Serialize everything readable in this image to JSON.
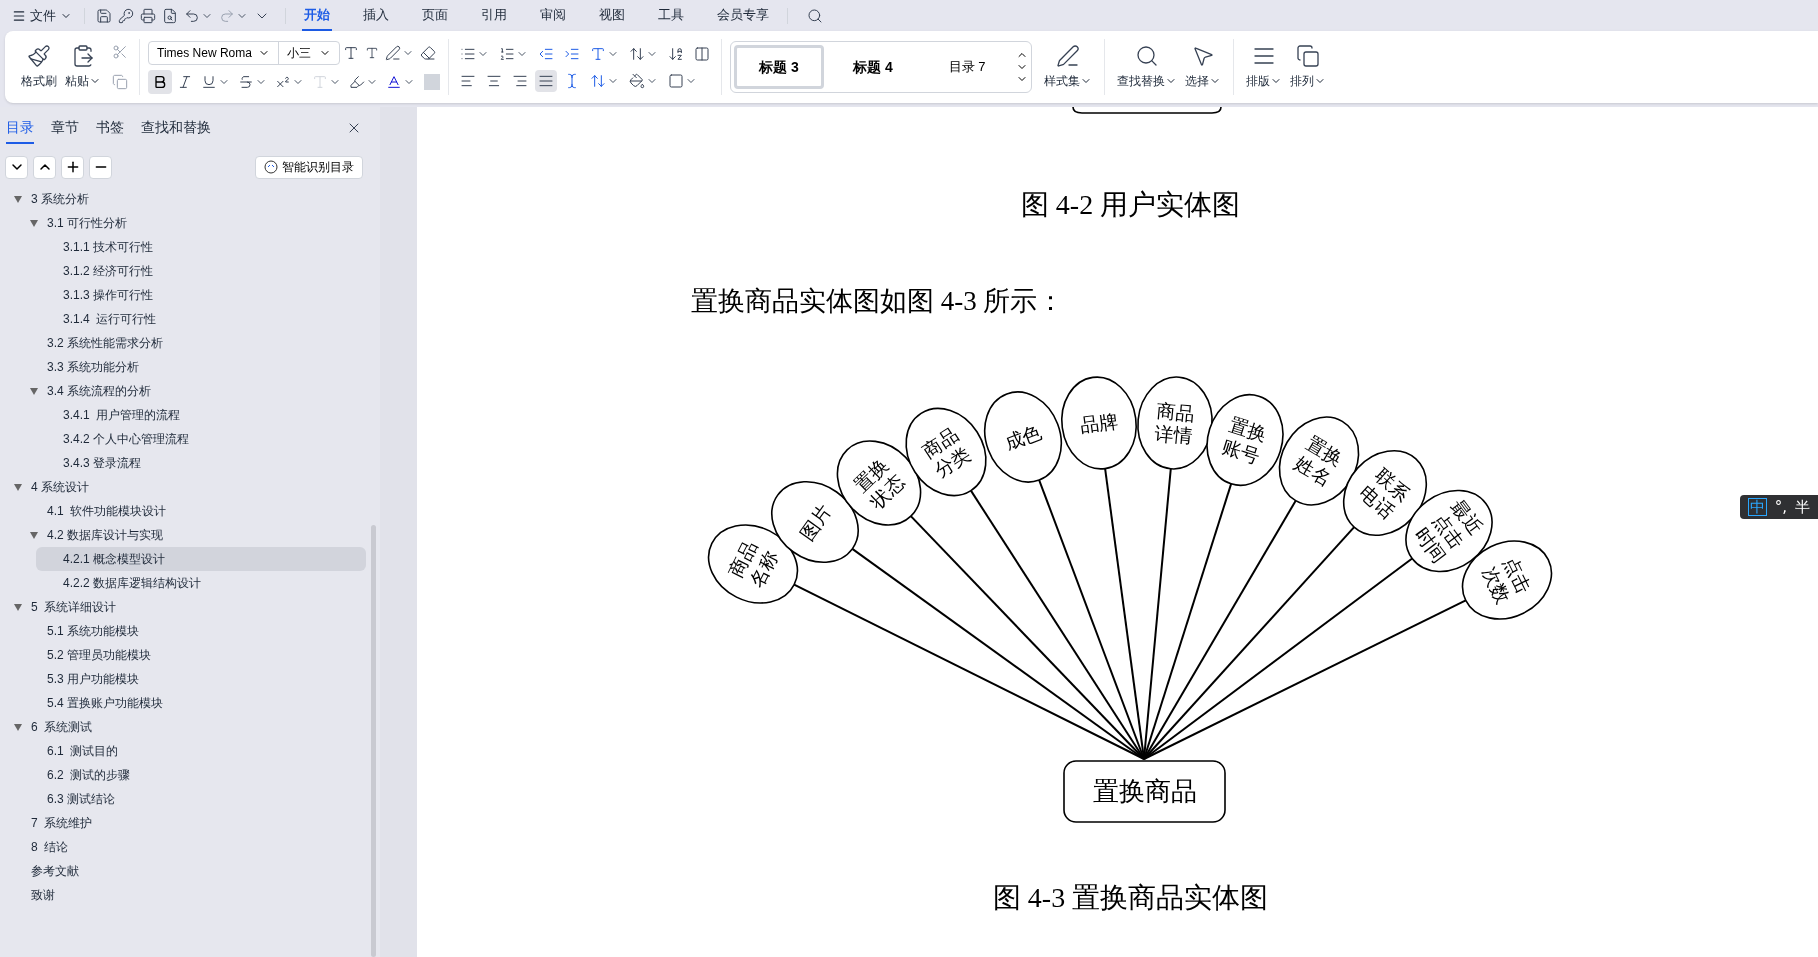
{
  "menu_bar": {
    "file_menu": "文件",
    "tabs": [
      {
        "label": "开始",
        "selected": true
      },
      {
        "label": "插入",
        "selected": false
      },
      {
        "label": "页面",
        "selected": false
      },
      {
        "label": "引用",
        "selected": false
      },
      {
        "label": "审阅",
        "selected": false
      },
      {
        "label": "视图",
        "selected": false
      },
      {
        "label": "工具",
        "selected": false
      },
      {
        "label": "会员专享",
        "selected": false
      }
    ]
  },
  "ribbon": {
    "format_painter": "格式刷",
    "paste": "粘贴",
    "font_name": "Times New Roma",
    "font_size": "小三",
    "bold": true,
    "justified": true,
    "styles": [
      {
        "label": "标题 3",
        "selected": true
      },
      {
        "label": "标题 4",
        "selected": false
      },
      {
        "label": "目录 7",
        "selected": false
      }
    ],
    "style_set": "样式集",
    "find_replace": "查找替换",
    "select": "选择",
    "layout": "排版",
    "arrange": "排列"
  },
  "sidebar": {
    "tabs": [
      {
        "label": "目录",
        "selected": true
      },
      {
        "label": "章节",
        "selected": false
      },
      {
        "label": "书签",
        "selected": false
      },
      {
        "label": "查找和替换",
        "selected": false
      }
    ],
    "smart_toc_button": "智能识别目录",
    "tree": [
      {
        "label": "3 系统分析",
        "selected": false,
        "expanded": true,
        "children": [
          {
            "label": "3.1 可行性分析",
            "selected": false,
            "expanded": true,
            "children": [
              {
                "label": "3.1.1 技术可行性",
                "selected": false
              },
              {
                "label": "3.1.2 经济可行性",
                "selected": false
              },
              {
                "label": "3.1.3 操作可行性",
                "selected": false
              },
              {
                "label": "3.1.4  运行可行性",
                "selected": false
              }
            ]
          },
          {
            "label": "3.2 系统性能需求分析",
            "selected": false
          },
          {
            "label": "3.3 系统功能分析",
            "selected": false
          },
          {
            "label": "3.4 系统流程的分析",
            "selected": false,
            "expanded": true,
            "children": [
              {
                "label": "3.4.1  用户管理的流程",
                "selected": false
              },
              {
                "label": "3.4.2 个人中心管理流程",
                "selected": false
              },
              {
                "label": "3.4.3 登录流程",
                "selected": false
              }
            ]
          }
        ]
      },
      {
        "label": "4 系统设计",
        "selected": false,
        "expanded": true,
        "children": [
          {
            "label": "4.1  软件功能模块设计",
            "selected": false
          },
          {
            "label": "4.2 数据库设计与实现",
            "selected": false,
            "expanded": true,
            "children": [
              {
                "label": "4.2.1 概念模型设计",
                "selected": true
              },
              {
                "label": "4.2.2 数据库逻辑结构设计",
                "selected": false
              }
            ]
          }
        ]
      },
      {
        "label": "5  系统详细设计",
        "selected": false,
        "expanded": true,
        "children": [
          {
            "label": "5.1 系统功能模块",
            "selected": false
          },
          {
            "label": "5.2 管理员功能模块",
            "selected": false
          },
          {
            "label": "5.3 用户功能模块",
            "selected": false
          },
          {
            "label": "5.4 置换账户功能模块",
            "selected": false
          }
        ]
      },
      {
        "label": "6  系统测试",
        "selected": false,
        "expanded": true,
        "children": [
          {
            "label": "6.1  测试目的",
            "selected": false
          },
          {
            "label": "6.2  测试的步骤",
            "selected": false
          },
          {
            "label": "6.3 测试结论",
            "selected": false
          }
        ]
      },
      {
        "label": "7  系统维护",
        "selected": false
      },
      {
        "label": "8  结论",
        "selected": false
      },
      {
        "label": "参考文献",
        "selected": false
      },
      {
        "label": "致谢",
        "selected": false
      }
    ]
  },
  "document": {
    "caption_1": "图 4-2 用户实体图",
    "paragraph": "置换商品实体图如图 4-3 所示：",
    "diagram": {
      "entity": "置换商品",
      "attributes": [
        "商品名称",
        "图片",
        "置换状态",
        "商品分类",
        "成色",
        "品牌",
        "商品详情",
        "置换账号",
        "置换姓名",
        "联系电话",
        "最近点击时间",
        "点击次数"
      ]
    },
    "caption_2": "图 4-3 置换商品实体图"
  },
  "ime_indicator": {
    "mode": "中",
    "punctuation": "°,",
    "width": "半"
  }
}
